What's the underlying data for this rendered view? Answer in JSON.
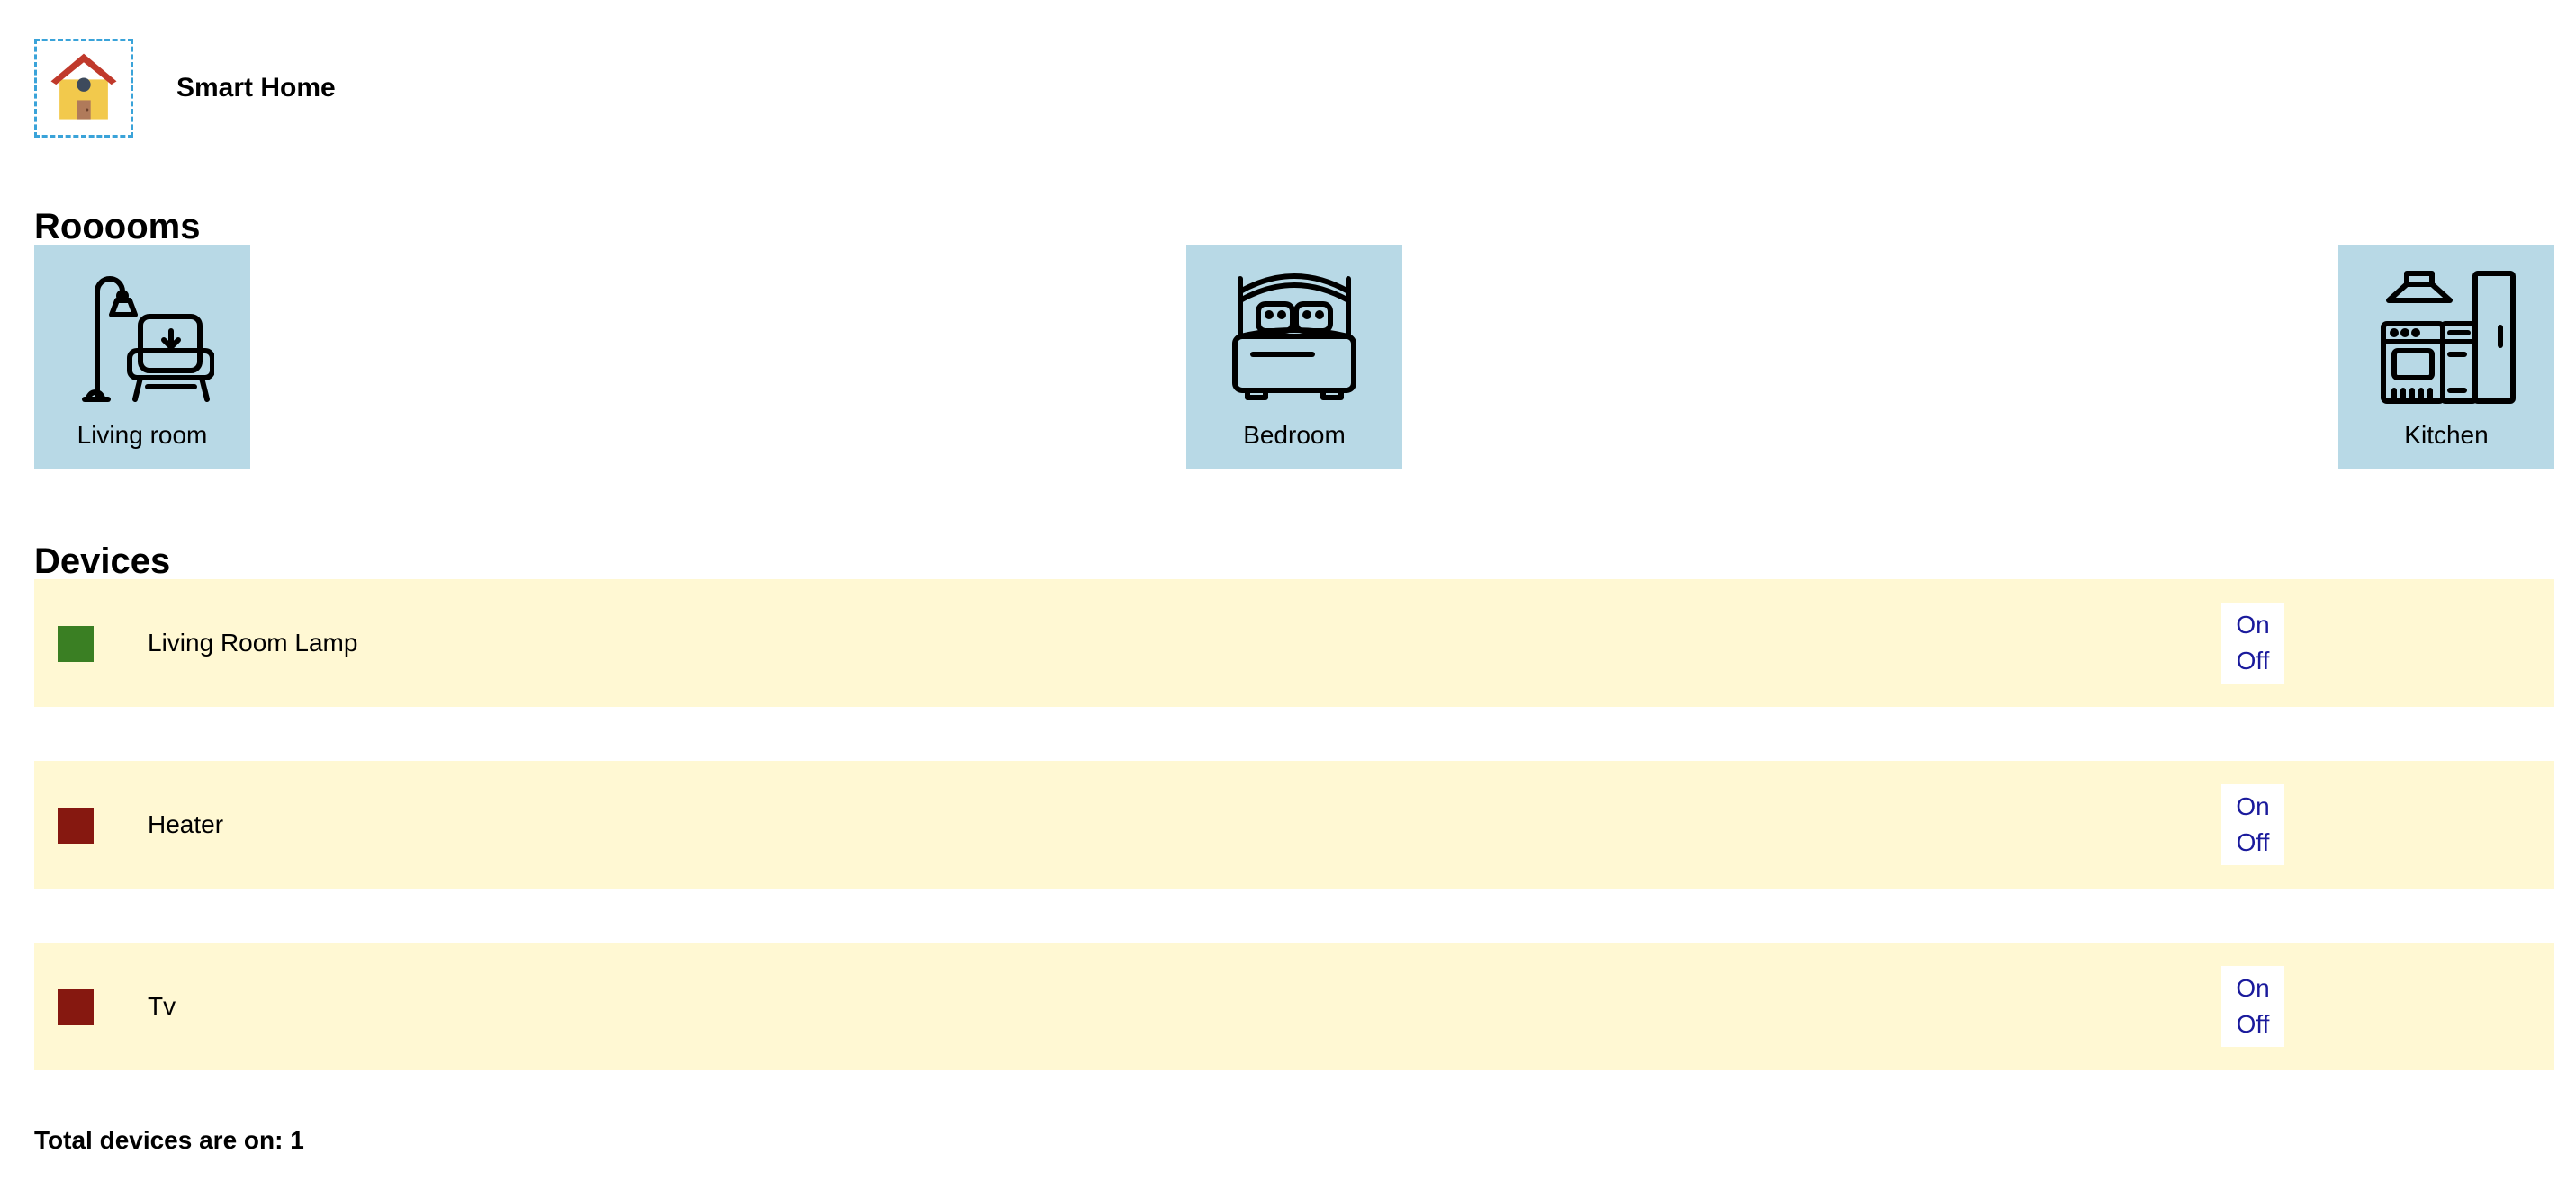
{
  "header": {
    "title": "Smart Home",
    "logo_icon": "house-icon"
  },
  "rooms": {
    "title": "Rooooms",
    "items": [
      {
        "label": "Living room",
        "icon": "living-room-icon"
      },
      {
        "label": "Bedroom",
        "icon": "bed-icon"
      },
      {
        "label": "Kitchen",
        "icon": "kitchen-icon"
      }
    ]
  },
  "devices": {
    "title": "Devices",
    "items": [
      {
        "name": "Living Room Lamp",
        "status_color": "#3a7f23",
        "on_label": "On",
        "off_label": "Off"
      },
      {
        "name": "Heater",
        "status_color": "#861810",
        "on_label": "On",
        "off_label": "Off"
      },
      {
        "name": "Tv",
        "status_color": "#861810",
        "on_label": "On",
        "off_label": "Off"
      }
    ]
  },
  "summary": {
    "total_text": "Total devices are on: 1"
  },
  "colors": {
    "room_card_bg": "#b8d9e6",
    "device_row_bg": "#fff8d3",
    "toggle_text": "#1a1a9c"
  }
}
